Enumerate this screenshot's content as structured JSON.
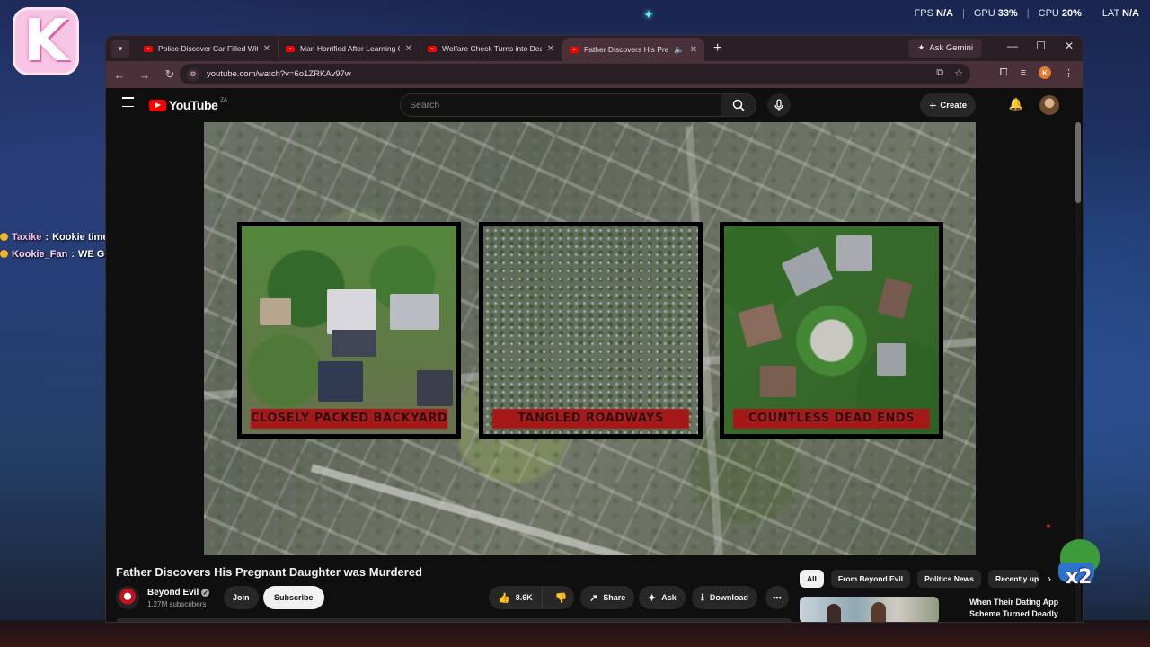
{
  "overlay": {
    "logo_letter": "K",
    "perf": {
      "fps_label": "FPS",
      "fps_value": "N/A",
      "gpu_label": "GPU",
      "gpu_value": "33%",
      "cpu_label": "CPU",
      "cpu_value": "20%",
      "lat_label": "LAT",
      "lat_value": "N/A",
      "separator": "|"
    },
    "chat": [
      {
        "user": "Taxike",
        "message": "Kookie time to boot up Rust"
      },
      {
        "user": "Kookie_Fan",
        "message": "WE GOOD"
      }
    ],
    "multiplier": "x2"
  },
  "browser": {
    "tabs": [
      {
        "title": "Police Discover Car Filled With",
        "active": false
      },
      {
        "title": "Man Horrified After Learning G",
        "active": false
      },
      {
        "title": "Welfare Check Turns into Dead",
        "active": false
      },
      {
        "title": "Father Discovers His Pregna",
        "active": true
      }
    ],
    "new_tab": "+",
    "ask_gemini": "Ask Gemini",
    "url": "youtube.com/watch?v=6o1ZRKAv97w",
    "profile_letter": "K"
  },
  "youtube": {
    "logo_text": "YouTube",
    "country_code": "ZA",
    "search_placeholder": "Search",
    "create_label": "Create",
    "video": {
      "panels": [
        {
          "caption": "CLOSELY PACKED BACKYARDS"
        },
        {
          "caption": "TANGLED ROADWAYS"
        },
        {
          "caption": "COUNTLESS DEAD ENDS"
        }
      ]
    },
    "title": "Father Discovers His Pregnant Daughter was Murdered",
    "channel": {
      "name": "Beyond Evil",
      "subscribers": "1.27M subscribers",
      "join": "Join",
      "subscribe": "Subscribe"
    },
    "actions": {
      "likes": "8.6K",
      "share": "Share",
      "ask": "Ask",
      "download": "Download"
    },
    "chips": [
      {
        "label": "All",
        "active": true
      },
      {
        "label": "From Beyond Evil",
        "active": false
      },
      {
        "label": "Politics News",
        "active": false
      },
      {
        "label": "Recently up",
        "active": false
      }
    ],
    "recommended": {
      "title": "When Their Dating App Scheme Turned Deadly"
    }
  }
}
